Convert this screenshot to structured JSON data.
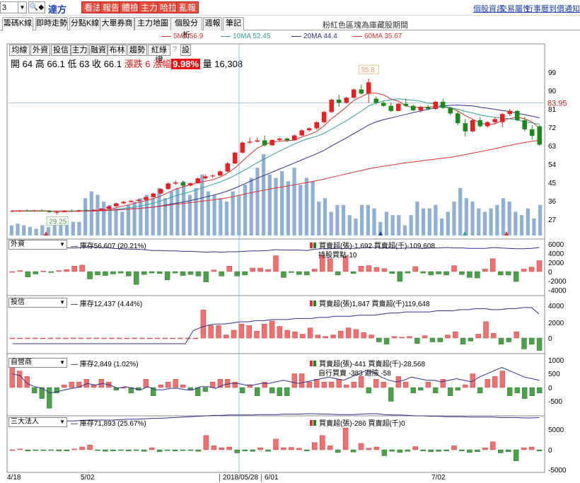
{
  "toolbar": {
    "code_value": "3",
    "stock_name": "達方",
    "red_buttons": [
      "看法",
      "報告",
      "體檢",
      "主力",
      "哈拉",
      "亂報"
    ],
    "links": [
      "個股資訊",
      "交易屬性",
      "行事曆",
      "到價通知"
    ]
  },
  "tabs": {
    "items": [
      "籌碼K線",
      "即時走勢",
      "分點K線",
      "大單券商",
      "主力地圖",
      "個股分析",
      "週報",
      "筆記"
    ],
    "active": 0,
    "note": "粉紅色區塊為庫藏股期間"
  },
  "ma_legend": [
    {
      "label": "5MA 56.9",
      "color": "#e03030"
    },
    {
      "label": "10MA 52.45",
      "color": "#30a0a0"
    },
    {
      "label": "20MA 44.4",
      "color": "#303090"
    },
    {
      "label": "60MA 35.67",
      "color": "#e03030"
    }
  ],
  "price_buttons": [
    "均線",
    "外資",
    "投信",
    "主力",
    "融資",
    "布林",
    "趨勢",
    "紅綠燈",
    "?",
    "設"
  ],
  "ohlc": {
    "open_label": "開",
    "open": "64",
    "high_label": "高",
    "high": "66.1",
    "low_label": "低",
    "low": "63",
    "close_label": "收",
    "close": "66.1",
    "chg_label": "漲跌",
    "chg": "6",
    "pct_label": "漲幅",
    "pct": "9.98%",
    "vol_label": "量",
    "vol": "16,308"
  },
  "price_axis": {
    "ticks": [
      "99",
      "90",
      "81",
      "72",
      "63",
      "54",
      "45",
      "36",
      "27"
    ],
    "current": "83.95",
    "high_mark": "95.8",
    "low_mark": "29.25"
  },
  "panels": [
    {
      "name": "外資",
      "inventory": "庫存56,607 (20.21%)",
      "buysell": "買賣超(張)-1,692 買賣超(千)-109,608",
      "extra": "持股買點-10",
      "ticks": [
        "6000",
        "4000",
        "2000",
        "0",
        "-2000",
        "-4000"
      ]
    },
    {
      "name": "投信",
      "inventory": "庫存12,437 (4.44%)",
      "buysell": "買賣超(張)1,847 買賣超(千)119,648",
      "extra": "",
      "ticks": [
        "4000",
        "2000",
        "0"
      ]
    },
    {
      "name": "自營商",
      "inventory": "庫存2,849 (1.02%)",
      "buysell": "買賣超(張)-441 買賣超(千)-28,568",
      "extra": "自行買賣 -383 避險 -58",
      "ticks": [
        "1000",
        "500",
        "0",
        "-500"
      ]
    },
    {
      "name": "三大法人",
      "inventory": "庫存71,893 (25.67%)",
      "buysell": "買賣超(張)-286 買賣超(千)0",
      "extra": "",
      "ticks": [
        "5000",
        "0",
        "-5000"
      ]
    }
  ],
  "x_axis": {
    "labels": [
      "4/18",
      "5/02",
      "2018/05/28",
      "6/01",
      "7/02"
    ]
  },
  "chart_data": {
    "type": "candlestick",
    "title": "",
    "candles": [
      [
        31,
        31.5,
        30.5,
        31
      ],
      [
        31,
        31.5,
        30.5,
        31.2
      ],
      [
        31.2,
        31.8,
        30.8,
        31
      ],
      [
        31,
        31.6,
        30.6,
        31.3
      ],
      [
        31.3,
        31.9,
        30.9,
        31
      ],
      [
        31,
        31.4,
        30.2,
        30.5
      ],
      [
        30.5,
        31,
        29.25,
        30.5
      ],
      [
        30.5,
        31.5,
        30.3,
        31.2
      ],
      [
        31.2,
        31.8,
        30.6,
        31
      ],
      [
        31,
        31.6,
        30.5,
        31.4
      ],
      [
        31.4,
        31.8,
        30.8,
        31.2
      ],
      [
        31.2,
        31.8,
        30.8,
        31.6
      ],
      [
        31.6,
        32.5,
        31.2,
        32.2
      ],
      [
        32.2,
        33.5,
        32,
        33.3
      ],
      [
        33.3,
        35,
        33,
        34.8
      ],
      [
        34.8,
        36,
        34.5,
        35.5
      ],
      [
        35.5,
        36.5,
        35,
        36
      ],
      [
        36,
        37,
        35.5,
        36.5
      ],
      [
        36.5,
        38,
        36.2,
        37.8
      ],
      [
        37.8,
        40,
        37.5,
        39.6
      ],
      [
        39.6,
        42,
        39.2,
        41.8
      ],
      [
        41.8,
        45,
        41.5,
        44.5
      ],
      [
        44.5,
        46,
        43.8,
        45
      ],
      [
        45,
        46,
        43.2,
        43.5
      ],
      [
        43.5,
        45,
        43,
        44.6
      ],
      [
        44.6,
        47.5,
        44.5,
        47
      ],
      [
        47,
        49,
        46.5,
        48
      ],
      [
        48,
        49,
        47.2,
        48.4
      ],
      [
        48.4,
        51,
        48.2,
        50.4
      ],
      [
        50.4,
        55,
        50,
        54.3
      ],
      [
        54.3,
        60,
        54,
        59.6
      ],
      [
        59.6,
        65,
        59.2,
        64.5
      ],
      [
        64.5,
        67,
        63.8,
        65
      ],
      [
        65,
        67,
        64.6,
        65.6
      ],
      [
        65.6,
        68,
        62.5,
        63.2
      ],
      [
        63.2,
        66,
        63,
        65.8
      ],
      [
        65.8,
        67,
        65,
        66.5
      ],
      [
        66.5,
        67,
        64.8,
        65.6
      ],
      [
        65.6,
        68.5,
        65.3,
        68
      ],
      [
        68,
        71,
        67.8,
        70.5
      ],
      [
        70.5,
        72,
        70,
        71.5
      ],
      [
        71.5,
        75,
        71,
        74.5
      ],
      [
        74.5,
        80,
        74,
        79.5
      ],
      [
        79.5,
        86,
        79,
        85.5
      ],
      [
        85.5,
        88,
        82,
        84
      ],
      [
        84,
        87,
        83.5,
        86.5
      ],
      [
        86.5,
        91,
        86,
        90.5
      ],
      [
        90.5,
        93,
        88,
        88.5
      ],
      [
        88.5,
        95.8,
        84,
        94
      ],
      [
        86,
        87,
        83,
        84
      ],
      [
        84,
        85,
        82,
        82.5
      ],
      [
        82.5,
        84,
        79.5,
        80
      ],
      [
        80,
        84,
        79.8,
        83.5
      ],
      [
        83.5,
        86,
        82,
        82.5
      ],
      [
        82.5,
        83,
        80,
        80.3
      ],
      [
        80.3,
        82.5,
        79.2,
        82
      ],
      [
        82,
        83,
        80.5,
        81
      ],
      [
        81,
        85,
        80.5,
        84.5
      ],
      [
        84.5,
        86,
        81,
        81.5
      ],
      [
        81.5,
        82,
        78,
        78.8
      ],
      [
        78.8,
        80,
        73,
        74
      ],
      [
        74,
        76,
        67.5,
        70
      ],
      [
        70,
        76,
        69.5,
        75.5
      ],
      [
        75.5,
        77,
        72,
        72.5
      ],
      [
        72.5,
        75,
        71.8,
        74.5
      ],
      [
        74.5,
        77,
        73.5,
        76
      ],
      [
        74.5,
        79,
        72,
        78.5
      ],
      [
        78.5,
        81,
        77.5,
        80
      ],
      [
        80,
        80.5,
        75,
        75.5
      ],
      [
        75.5,
        77,
        70,
        71
      ],
      [
        71,
        73,
        66,
        67.8
      ],
      [
        72.5,
        73,
        63,
        63.5
      ]
    ],
    "volume": [
      3,
      3.5,
      3,
      2.5,
      2,
      3,
      2.5,
      3,
      3.5,
      3,
      4,
      4,
      11,
      13,
      12,
      10,
      9,
      8,
      7,
      9,
      10,
      11,
      12,
      11,
      14,
      11,
      13,
      14,
      16,
      12,
      14,
      18,
      13,
      12,
      11,
      10,
      13,
      12,
      15,
      17,
      20,
      24,
      18,
      17,
      19,
      16,
      20,
      15,
      17,
      16,
      10,
      11,
      7,
      9,
      9,
      6,
      5,
      9,
      9,
      8,
      4,
      7,
      6,
      6,
      3,
      6,
      10,
      8,
      8,
      9,
      5,
      7,
      10,
      14,
      11,
      10,
      8,
      7,
      8,
      9,
      11,
      10,
      7,
      6,
      8,
      5,
      9
    ]
  }
}
